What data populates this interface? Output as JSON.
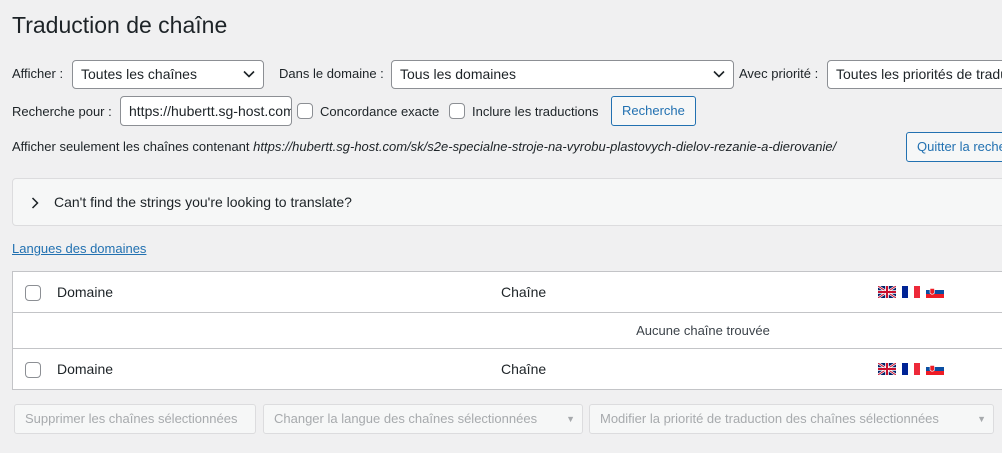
{
  "page": {
    "title": "Traduction de chaîne"
  },
  "filters": {
    "show_label": "Afficher :",
    "show_value": "Toutes les chaînes",
    "domain_label": "Dans le domaine :",
    "domain_value": "Tous les domaines",
    "priority_label": "Avec priorité :",
    "priority_value": "Toutes les priorités de traduction"
  },
  "search": {
    "label": "Recherche pour :",
    "value": "https://hubertt.sg-host.com",
    "exact_label": "Concordance exacte",
    "include_label": "Inclure les traductions",
    "button": "Recherche"
  },
  "url_filter": {
    "prefix": "Afficher seulement les chaînes contenant",
    "url": "https://hubertt.sg-host.com/sk/s2e-specialne-stroje-na-vyrobu-plastovych-dielov-rezanie-a-dierovanie/",
    "quit_button": "Quitter la recherche"
  },
  "notice": {
    "text": "Can't find the strings you're looking to translate?"
  },
  "domain_languages_link": "Langues des domaines",
  "table": {
    "col_domain": "Domaine",
    "col_string": "Chaîne",
    "empty": "Aucune chaîne trouvée",
    "flags": [
      "gb-flag",
      "fr-flag",
      "sk-flag"
    ]
  },
  "bulk": {
    "delete": "Supprimer les chaînes sélectionnées",
    "change_lang": "Changer la langue des chaînes sélectionnées",
    "change_priority": "Modifier la priorité de traduction des chaînes sélectionnées"
  }
}
